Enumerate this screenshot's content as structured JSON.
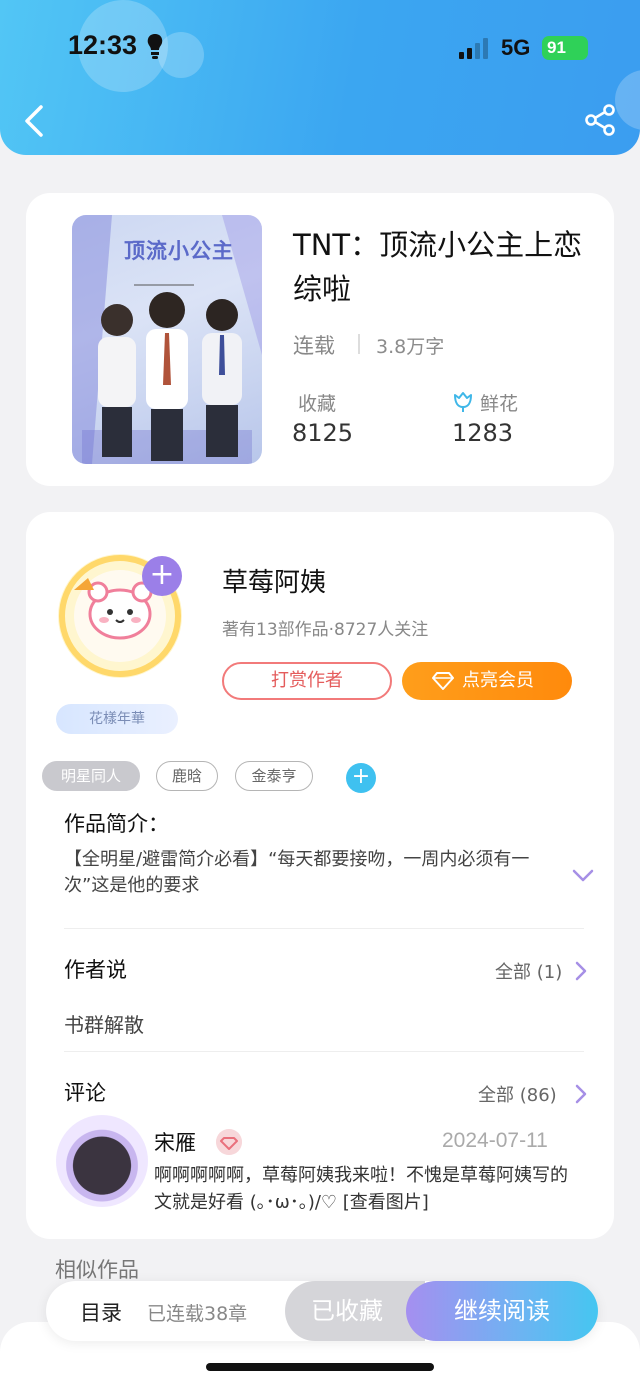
{
  "status_bar": {
    "time": "12:33",
    "network": "5G",
    "battery": "91"
  },
  "book": {
    "title": "TNT：顶流小公主上恋综啦",
    "cover_text": "顶流小公主",
    "status": "连载",
    "word_count": "3.8万字",
    "favorites_label": "收藏",
    "favorites_value": "8125",
    "flowers_label": "鲜花",
    "flowers_value": "1283"
  },
  "author": {
    "name": "草莓阿姨",
    "meta": "著有13部作品·8727人关注",
    "badge": "花樣年華",
    "tip_label": "打赏作者",
    "vip_label": "点亮会员"
  },
  "tags": [
    "明星同人",
    "鹿晗",
    "金泰亨"
  ],
  "intro": {
    "title": "作品简介：",
    "text": "【全明星/避雷简介必看】“每天都要接吻，一周内必须有一次”这是他的要求"
  },
  "author_says": {
    "title": "作者说",
    "see_all": "全部 (1)",
    "text": "书群解散"
  },
  "comments": {
    "title": "评论",
    "see_all": "全部 (86)",
    "items": [
      {
        "user": "宋雁",
        "date": "2024-07-11",
        "text": "啊啊啊啊啊，草莓阿姨我来啦！不愧是草莓阿姨写的文就是好看 (｡･ω･｡)/♡ [查看图片]"
      }
    ]
  },
  "similar_title": "相似作品",
  "bottom_bar": {
    "toc_label": "目录",
    "chapter_count": "已连载38章",
    "fav_label": "已收藏",
    "read_label": "继续阅读"
  },
  "colors": {
    "header_start": "#52c6f5",
    "header_end": "#3b9df0",
    "vip_orange": "#ff9e1b",
    "tip_red": "#e45c5c",
    "accent_purple": "#9b7fe8"
  }
}
